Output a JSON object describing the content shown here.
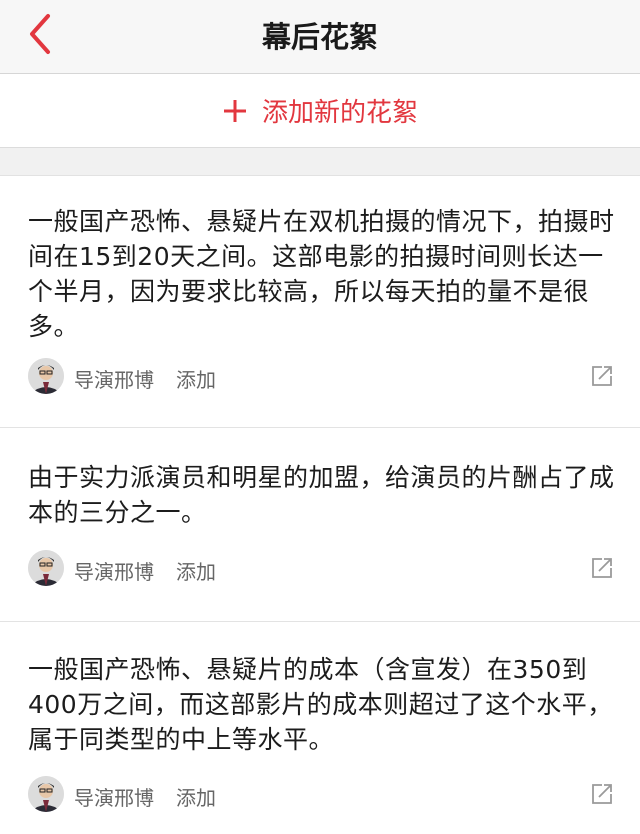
{
  "header": {
    "title": "幕后花絮",
    "back_icon": "chevron-left-icon"
  },
  "add_action": {
    "label": "添加新的花絮",
    "icon": "plus-icon"
  },
  "colors": {
    "accent": "#e2373f",
    "separator": "#f1f1f1",
    "meta_text": "#666666"
  },
  "items": [
    {
      "text": "一般国产恐怖、悬疑片在双机拍摄的情况下，拍摄时间在15到20天之间。这部电影的拍摄时间则长达一个半月，因为要求比较高，所以每天拍的量不是很多。",
      "author": "导演邢博",
      "action": "添加",
      "share_icon": "share-icon"
    },
    {
      "text": "由于实力派演员和明星的加盟，给演员的片酬占了成本的三分之一。",
      "author": "导演邢博",
      "action": "添加",
      "share_icon": "share-icon"
    },
    {
      "text": "一般国产恐怖、悬疑片的成本（含宣发）在350到400万之间，而这部影片的成本则超过了这个水平，属于同类型的中上等水平。",
      "author": "导演邢博",
      "action": "添加",
      "share_icon": "share-icon"
    }
  ]
}
